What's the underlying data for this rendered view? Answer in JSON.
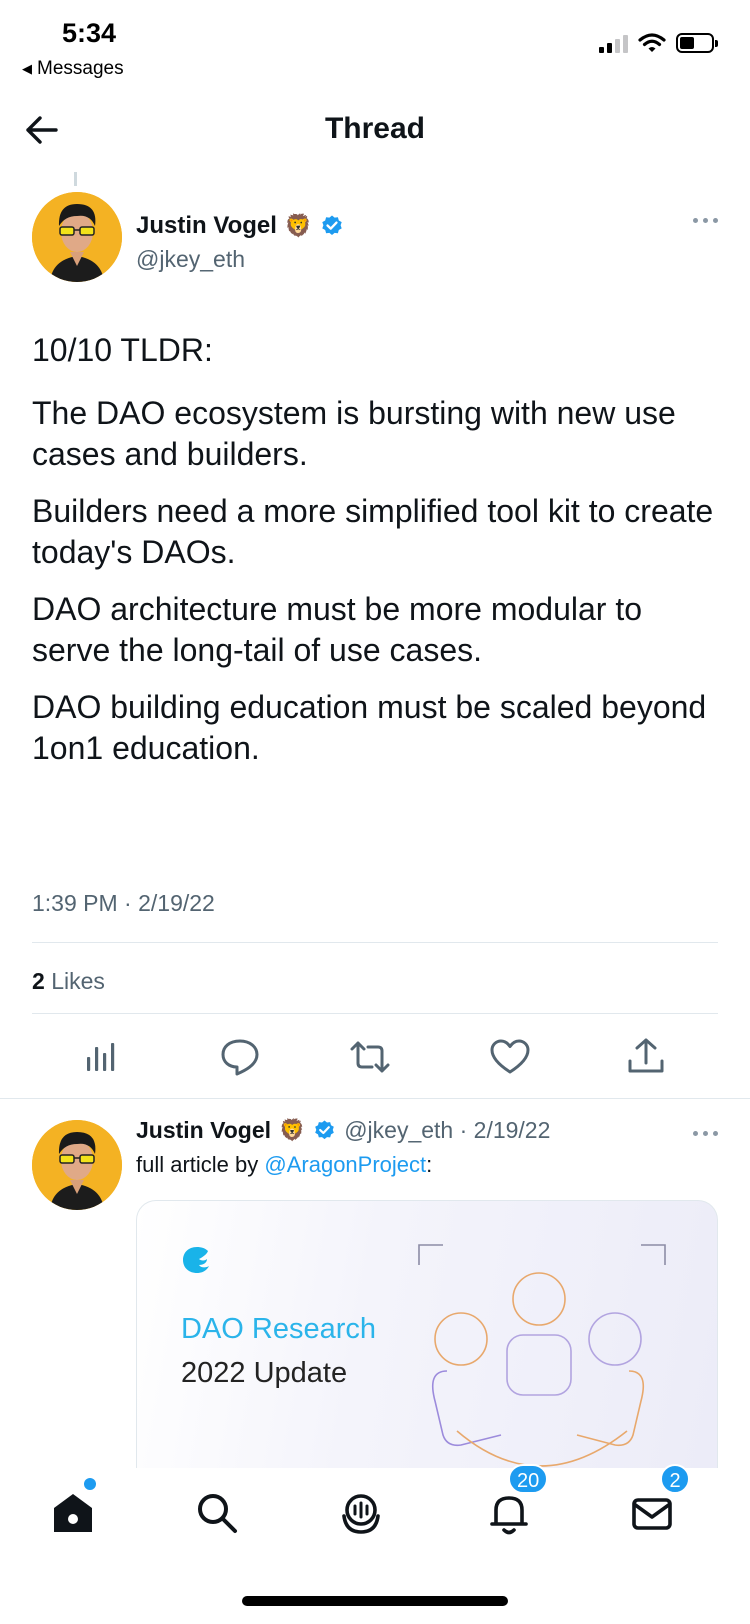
{
  "status_bar": {
    "time": "5:34",
    "back_app": "Messages"
  },
  "header": {
    "title": "Thread",
    "back_icon": "arrow-left-icon"
  },
  "main_tweet": {
    "author_name": "Justin Vogel",
    "author_emoji": "🦁",
    "verified": true,
    "handle": "@jkey_eth",
    "paragraphs": [
      "10/10 TLDR:",
      "The DAO ecosystem is bursting with new use cases and builders.",
      "Builders need a more simplified tool kit to create today's DAOs.",
      "DAO architecture must be more modular to serve the long-tail of use cases.",
      "DAO building education must be scaled beyond 1on1 education."
    ],
    "timestamp": "1:39 PM · 2/19/22",
    "likes_count": "2",
    "likes_label": "Likes",
    "actions": [
      "analytics-icon",
      "reply-icon",
      "retweet-icon",
      "like-icon",
      "share-icon"
    ]
  },
  "reply_tweet": {
    "author_name": "Justin Vogel",
    "author_emoji": "🦁",
    "meta": "@jkey_eth · 2/19/22",
    "text_prefix": "full article by ",
    "mention": "@AragonProject",
    "text_suffix": ":",
    "card": {
      "title": "DAO Research",
      "subtitle": "2022 Update"
    }
  },
  "tabbar": {
    "tabs": [
      "home-icon",
      "search-icon",
      "spaces-icon",
      "notifications-icon",
      "messages-icon"
    ],
    "notifications_badge": "20",
    "messages_badge": "2"
  },
  "colors": {
    "accent": "#1d9bf0",
    "secondary_text": "#536471",
    "card_title": "#2bb4ea"
  }
}
